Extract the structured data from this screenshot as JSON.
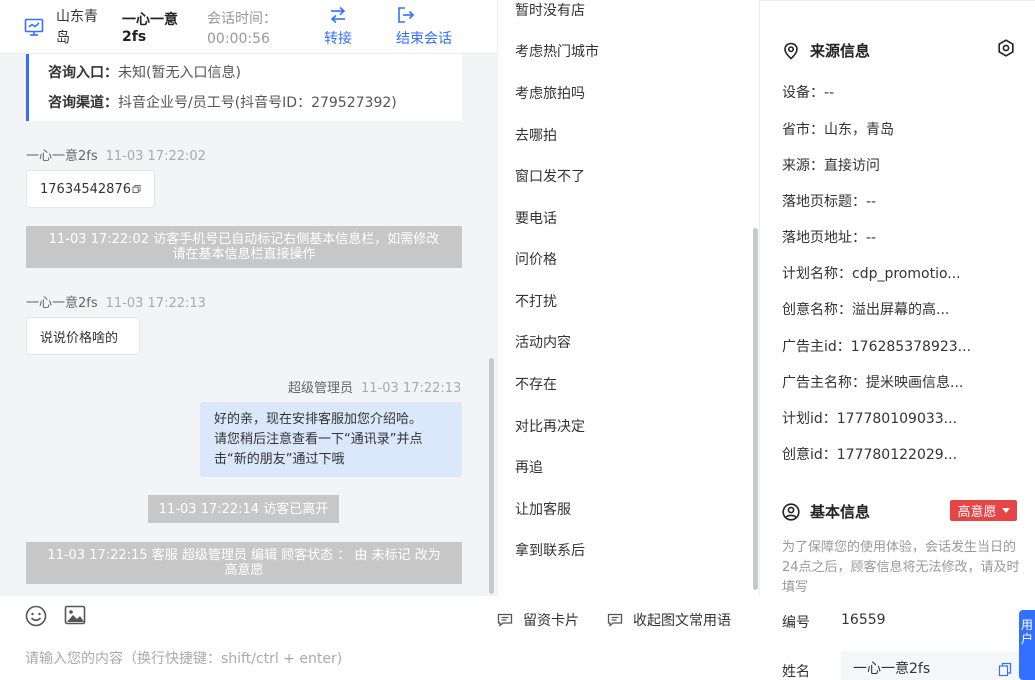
{
  "header": {
    "location": "山东青岛",
    "visitor_name": "一心一意2fs",
    "session_time_label": "会话时间：",
    "session_time_value": "00:00:56",
    "transfer_label": "转接",
    "end_label": "结束会话"
  },
  "info_card": {
    "entry_label": "咨询入口：",
    "entry_value": "未知(暂无入口信息)",
    "channel_label": "咨询渠道：",
    "channel_value": "抖音企业号/员工号(抖音号ID：279527392)"
  },
  "messages": {
    "m1_sender": "一心一意2fs",
    "m1_time": "11-03 17:22:02",
    "m1_text": "17634542876",
    "sys1_line1": "11-03 17:22:02 访客手机号已自动标记右侧基本信息栏，如需修改",
    "sys1_line2": "请在基本信息栏直接操作",
    "m2_sender": "一心一意2fs",
    "m2_time": "11-03 17:22:13",
    "m2_text": "说说价格啥的",
    "m3_sender": "超级管理员",
    "m3_time": "11-03 17:22:13",
    "m3_line1": "好的亲，现在安排客服加您介绍哈。",
    "m3_line2": "请您稍后注意查看一下“通讯录”并点",
    "m3_line3": "击“新的朋友”通过下哦",
    "sys2": "11-03 17:22:14 访客已离开",
    "sys3_line1": "11-03 17:22:15 客服 超级管理员 编辑 顾客状态 ： 由 未标记 改为",
    "sys3_line2": "高意愿"
  },
  "footer": {
    "card_label": "留资卡片",
    "phrases_label": "收起图文常用语",
    "input_placeholder": "请输入您的内容（换行快捷键：shift/ctrl + enter)"
  },
  "phrases": [
    "暂时没有店",
    "考虑热门城市",
    "考虑旅拍吗",
    "去哪拍",
    "窗口发不了",
    "要电话",
    "问价格",
    "不打扰",
    "活动内容",
    "不存在",
    "对比再决定",
    "再追",
    "让加客服",
    "拿到联系后"
  ],
  "source": {
    "title": "来源信息",
    "device": "设备：--",
    "province_city": "省市：山东，青岛",
    "origin": "来源：直接访问",
    "landing_title": "落地页标题：--",
    "landing_url": "落地页地址：--",
    "plan_name": "计划名称：cdp_promotio...",
    "creative_name": "创意名称：溢出屏幕的高...",
    "advertiser_id": "广告主id：176285378923...",
    "advertiser_name": "广告主名称：提米映画信息...",
    "plan_id": "计划id：177780109033...",
    "creative_id": "创意id：177780122029..."
  },
  "basic": {
    "title": "基本信息",
    "intent_badge": "高意愿",
    "note": "为了保障您的使用体验，会话发生当日的24点之后，顾客信息将无法修改，请及时填写",
    "number_label": "编号",
    "number_value": "16559",
    "name_label": "姓名",
    "name_value": "一心一意2fs"
  },
  "side_tab": "用户",
  "colors": {
    "accent": "#3370ff",
    "intent_red": "#e54545",
    "own_bubble": "#dbe7fb",
    "system_notice": "#c7c7c7"
  }
}
